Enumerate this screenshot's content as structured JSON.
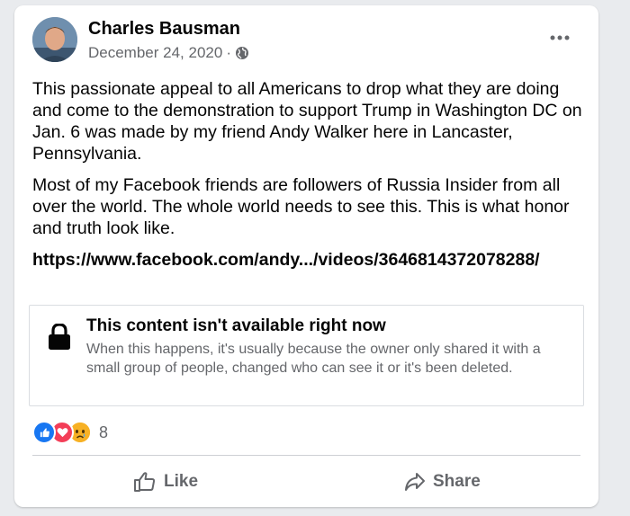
{
  "post": {
    "author": "Charles Bausman",
    "date": "December 24, 2020",
    "separator": "·",
    "privacy_icon": "globe-icon",
    "more_icon": "more-options-icon",
    "paragraphs": [
      "This passionate appeal to all Americans to drop what they are doing and come to the demonstration to support Trump in Washington DC on Jan. 6 was made by my friend Andy Walker here in Lancaster, Pennsylvania.",
      "Most of my Facebook friends are followers of Russia Insider from all over the world. The whole world needs to see this. This is what honor and truth look like."
    ],
    "link": "https://www.facebook.com/andy.../videos/3646814372078288/"
  },
  "unavailable": {
    "icon": "lock-icon",
    "title": "This content isn't available right now",
    "description": "When this happens, it's usually because the owner only shared it with a small group of people, changed who can see it or it's been deleted."
  },
  "reactions": {
    "icons": [
      "like-icon",
      "love-icon",
      "sad-icon"
    ],
    "count": "8"
  },
  "actions": {
    "like_label": "Like",
    "share_label": "Share"
  },
  "colors": {
    "like_blue": "#1877f2",
    "love_red": "#f33e58",
    "sad_yellow": "#f7b125",
    "secondary_text": "#65676b"
  }
}
